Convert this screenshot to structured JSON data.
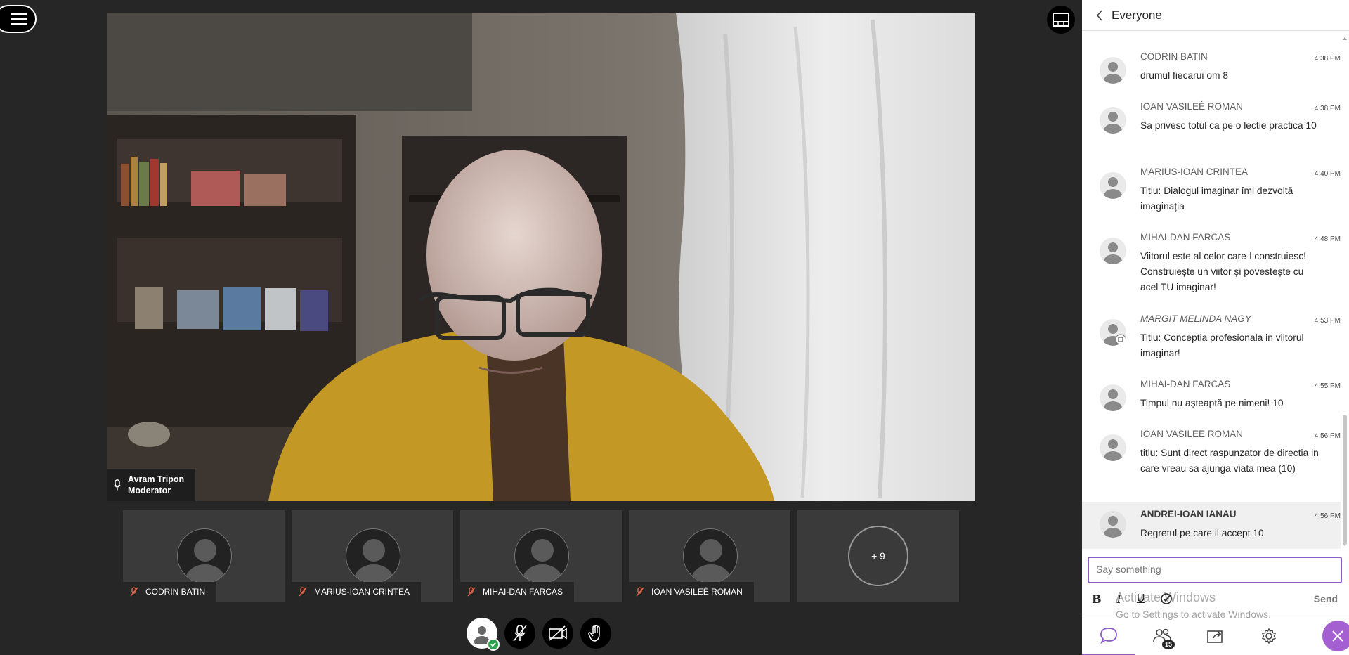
{
  "panel": {
    "title": "Everyone"
  },
  "stage": {
    "name": "Avram Tripon",
    "role": "Moderator"
  },
  "thumbs": [
    {
      "name": "CODRIN BATIN"
    },
    {
      "name": "MARIUS-IOAN CRINTEA"
    },
    {
      "name": "MIHAI-DAN FARCAS"
    },
    {
      "name": "IOAN VASILEĖ ROMAN"
    }
  ],
  "more_count": "+ 9",
  "messages": [
    {
      "author": "CODRIN BATIN",
      "time": "4:38 PM",
      "text": "drumul fiecarui om 8"
    },
    {
      "author": "IOAN VASILEĖ ROMAN",
      "time": "4:38 PM",
      "text": "Sa privesc totul ca pe o lectie practica 10"
    },
    {
      "author": "MARIUS-IOAN CRINTEA",
      "time": "4:40 PM",
      "text": "Titlu: Dialogul imaginar îmi dezvoltă imaginația"
    },
    {
      "author": "MIHAI-DAN FARCAS",
      "time": "4:48 PM",
      "text": "Viitorul este al celor care-l construiesc! Construiește un viitor și povestește cu acel TU imaginar!"
    },
    {
      "author": "MARGIT MELINDA NAGY",
      "time": "4:53 PM",
      "text": "Titlu: Conceptia profesionala in viitorul imaginar!"
    },
    {
      "author": "MIHAI-DAN FARCAS",
      "time": "4:55 PM",
      "text": "Timpul nu așteaptă pe nimeni! 10"
    },
    {
      "author": "IOAN VASILEĖ ROMAN",
      "time": "4:56 PM",
      "text": "titlu: Sunt direct raspunzator de directia in care vreau sa ajunga viata mea (10)"
    },
    {
      "author": "ANDREI-IOAN IANAU",
      "time": "4:56 PM",
      "text": "Regretul pe care il accept 10"
    }
  ],
  "compose": {
    "placeholder": "Say something",
    "send": "Send"
  },
  "formatting": {
    "bold": "B",
    "italic": "I",
    "underline": "U"
  },
  "watermark": {
    "line1": "Activate Windows",
    "line2": "Go to Settings to activate Windows."
  },
  "tabs": {
    "participants_badge": "15"
  },
  "colors": {
    "accent": "#8b5cc4",
    "online": "#2ca44d",
    "close_fab": "#a45fd0"
  }
}
